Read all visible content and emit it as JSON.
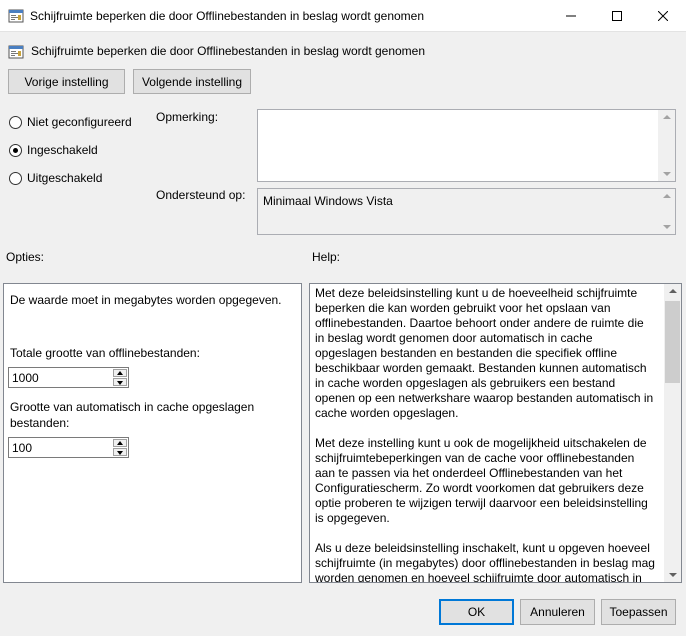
{
  "window": {
    "title": "Schijfruimte beperken die door Offlinebestanden in beslag wordt genomen",
    "controls": {
      "minimize_icon": "minimize-icon",
      "maximize_icon": "maximize-icon",
      "close_icon": "close-icon"
    }
  },
  "header": {
    "icon": "policy-setting-icon",
    "title": "Schijfruimte beperken die door Offlinebestanden in beslag wordt genomen"
  },
  "nav": {
    "previous_label": "Vorige instelling",
    "next_label": "Volgende instelling"
  },
  "state": {
    "options": [
      {
        "label": "Niet geconfigureerd",
        "selected": false
      },
      {
        "label": "Ingeschakeld",
        "selected": true
      },
      {
        "label": "Uitgeschakeld",
        "selected": false
      }
    ]
  },
  "comment": {
    "label": "Opmerking:",
    "value": ""
  },
  "supported": {
    "label": "Ondersteund op:",
    "value": "Minimaal Windows Vista"
  },
  "options_panel": {
    "heading": "Opties:",
    "intro": "De waarde moet in megabytes worden opgegeven.",
    "total_label": "Totale grootte van offlinebestanden:",
    "total_value": "1000",
    "auto_label_line1": "Grootte van automatisch in cache opgeslagen",
    "auto_label_line2": "bestanden:",
    "auto_value": "100"
  },
  "help_panel": {
    "heading": "Help:",
    "paragraphs": [
      "Met deze beleidsinstelling kunt u de hoeveelheid schijfruimte beperken die kan worden gebruikt voor het opslaan van offlinebestanden. Daartoe behoort onder andere de ruimte die in beslag wordt genomen door automatisch in cache opgeslagen bestanden en bestanden die specifiek offline beschikbaar worden gemaakt. Bestanden kunnen automatisch in cache worden opgeslagen als gebruikers een bestand openen op een netwerkshare waarop bestanden automatisch in cache worden opgeslagen.",
      "Met deze instelling kunt u ook de mogelijkheid uitschakelen de schijfruimtebeperkingen van de cache voor offlinebestanden aan te passen via het onderdeel Offlinebestanden van het Configuratiescherm. Zo wordt voorkomen dat gebruikers deze optie proberen te wijzigen terwijl daarvoor een beleidsinstelling is opgegeven.",
      "Als u deze beleidsinstelling inschakelt, kunt u opgeven hoeveel schijfruimte (in megabytes) door offlinebestanden in beslag mag worden genomen en hoeveel schijfruimte door automatisch in"
    ]
  },
  "footer": {
    "ok_label": "OK",
    "cancel_label": "Annuleren",
    "apply_label": "Toepassen"
  },
  "colors": {
    "accent": "#0078d7",
    "window_bg": "#f0f0f0",
    "border": "#adadad"
  }
}
